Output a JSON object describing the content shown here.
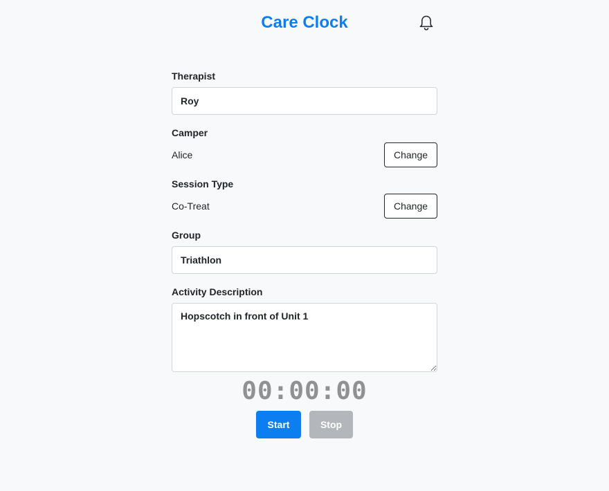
{
  "app": {
    "title": "Care Clock",
    "notifications_icon": "bell-icon"
  },
  "form": {
    "therapist": {
      "label": "Therapist",
      "value": "Roy"
    },
    "camper": {
      "label": "Camper",
      "value": "Alice",
      "change_label": "Change"
    },
    "session_type": {
      "label": "Session Type",
      "value": "Co-Treat",
      "change_label": "Change"
    },
    "group": {
      "label": "Group",
      "value": "Triathlon"
    },
    "activity": {
      "label": "Activity Description",
      "value": "Hopscotch in front of Unit 1"
    }
  },
  "timer": {
    "display": "00:00:00",
    "start_label": "Start",
    "stop_label": "Stop"
  },
  "colors": {
    "accent": "#0d7ef0",
    "background": "#f8f9fa",
    "disabled": "#b3b7bb",
    "timer_text": "#8f9193"
  }
}
